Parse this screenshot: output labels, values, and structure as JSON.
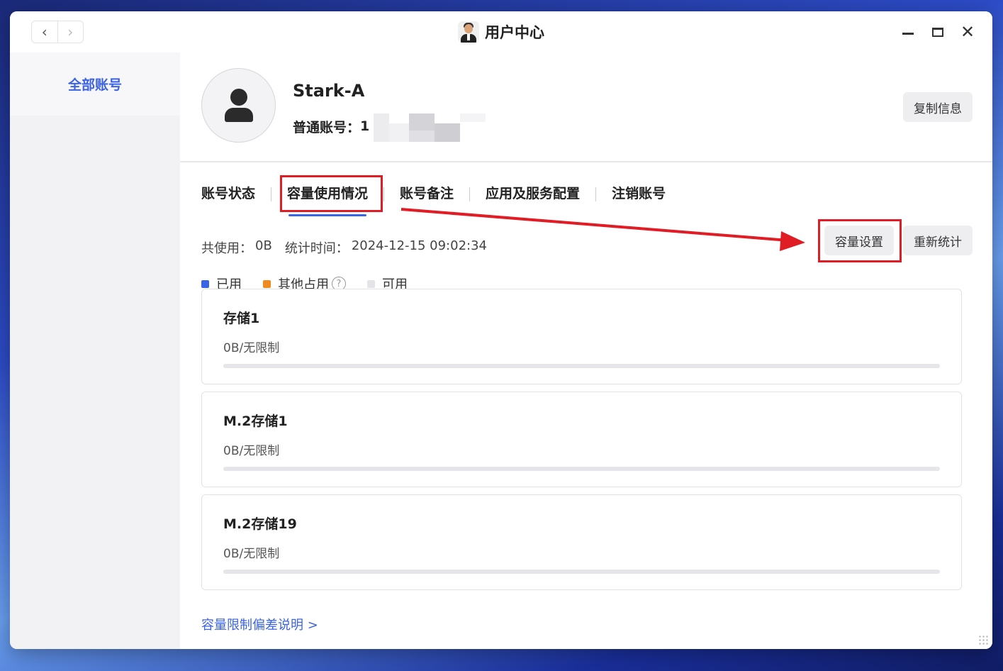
{
  "window": {
    "title": "用户中心",
    "nav_back": "‹",
    "nav_forward": "›",
    "close_symbol": "✕"
  },
  "sidebar": {
    "items": [
      {
        "label": "全部账号",
        "active": true
      }
    ]
  },
  "profile": {
    "name": "Stark-A",
    "account_label": "普通账号：",
    "account_value_visible": "1",
    "copy_button": "复制信息"
  },
  "tabs": [
    {
      "label": "账号状态",
      "active": false
    },
    {
      "label": "容量使用情况",
      "active": true
    },
    {
      "label": "账号备注",
      "active": false
    },
    {
      "label": "应用及服务配置",
      "active": false
    },
    {
      "label": "注销账号",
      "active": false
    }
  ],
  "stats": {
    "total_label": "共使用：",
    "total_value": "0B",
    "time_label": "统计时间：",
    "time_value": "2024-12-15 09:02:34"
  },
  "buttons": {
    "capacity_settings": "容量设置",
    "recount": "重新统计"
  },
  "legend": [
    {
      "label": "已用",
      "color": "#3b63e6"
    },
    {
      "label": "其他占用",
      "color": "#f08a1c",
      "help_icon": "?"
    },
    {
      "label": "可用",
      "color": "#e4e4e8"
    }
  ],
  "storages": [
    {
      "name": "存储1",
      "usage": "0B/无限制",
      "used_fraction": 0
    },
    {
      "name": "M.2存储1",
      "usage": "0B/无限制",
      "used_fraction": 0
    },
    {
      "name": "M.2存储19",
      "usage": "0B/无限制",
      "used_fraction": 0
    }
  ],
  "footer_link": "容量限制偏差说明 >",
  "annotation_color": "#e01c24"
}
